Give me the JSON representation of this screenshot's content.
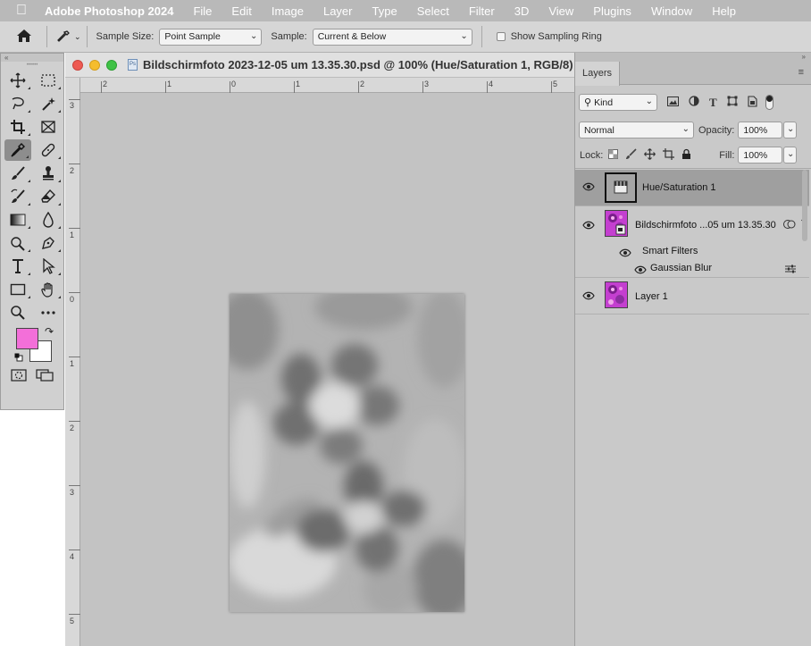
{
  "menubar": {
    "app_name": "Adobe Photoshop 2024",
    "items": [
      "File",
      "Edit",
      "Image",
      "Layer",
      "Type",
      "Select",
      "Filter",
      "3D",
      "View",
      "Plugins",
      "Window",
      "Help"
    ]
  },
  "options_bar": {
    "sample_size_label": "Sample Size:",
    "sample_size_value": "Point Sample",
    "sample_label": "Sample:",
    "sample_value": "Current & Below",
    "sampling_ring_label": "Show Sampling Ring"
  },
  "tools": {
    "foreground_color": "#f36fd9",
    "background_color": "#ffffff"
  },
  "document": {
    "title": "Bildschirmfoto 2023-12-05 um 13.35.30.psd @ 100% (Hue/Saturation 1, RGB/8)",
    "ruler_top_labels": [
      "2",
      "1",
      "0",
      "1",
      "2",
      "3",
      "4",
      "5"
    ],
    "ruler_left_labels": [
      "3",
      "2",
      "1",
      "0",
      "1",
      "2",
      "3",
      "4",
      "5"
    ]
  },
  "layers_panel": {
    "tab_label": "Layers",
    "filter_kind": "Kind",
    "blend_mode": "Normal",
    "opacity_label": "Opacity:",
    "opacity_value": "100%",
    "lock_label": "Lock:",
    "fill_label": "Fill:",
    "fill_value": "100%",
    "layers": [
      {
        "name": "Hue/Saturation 1",
        "selected": true
      },
      {
        "name": "Bildschirmfoto ...05 um 13.35.30"
      },
      {
        "name": "Smart Filters"
      },
      {
        "name": "Gaussian Blur"
      },
      {
        "name": "Layer 1"
      }
    ]
  },
  "colors": {
    "accent_selected_layer": "#9f9f9f",
    "thumbnail_magenta": "#c43fd0"
  }
}
